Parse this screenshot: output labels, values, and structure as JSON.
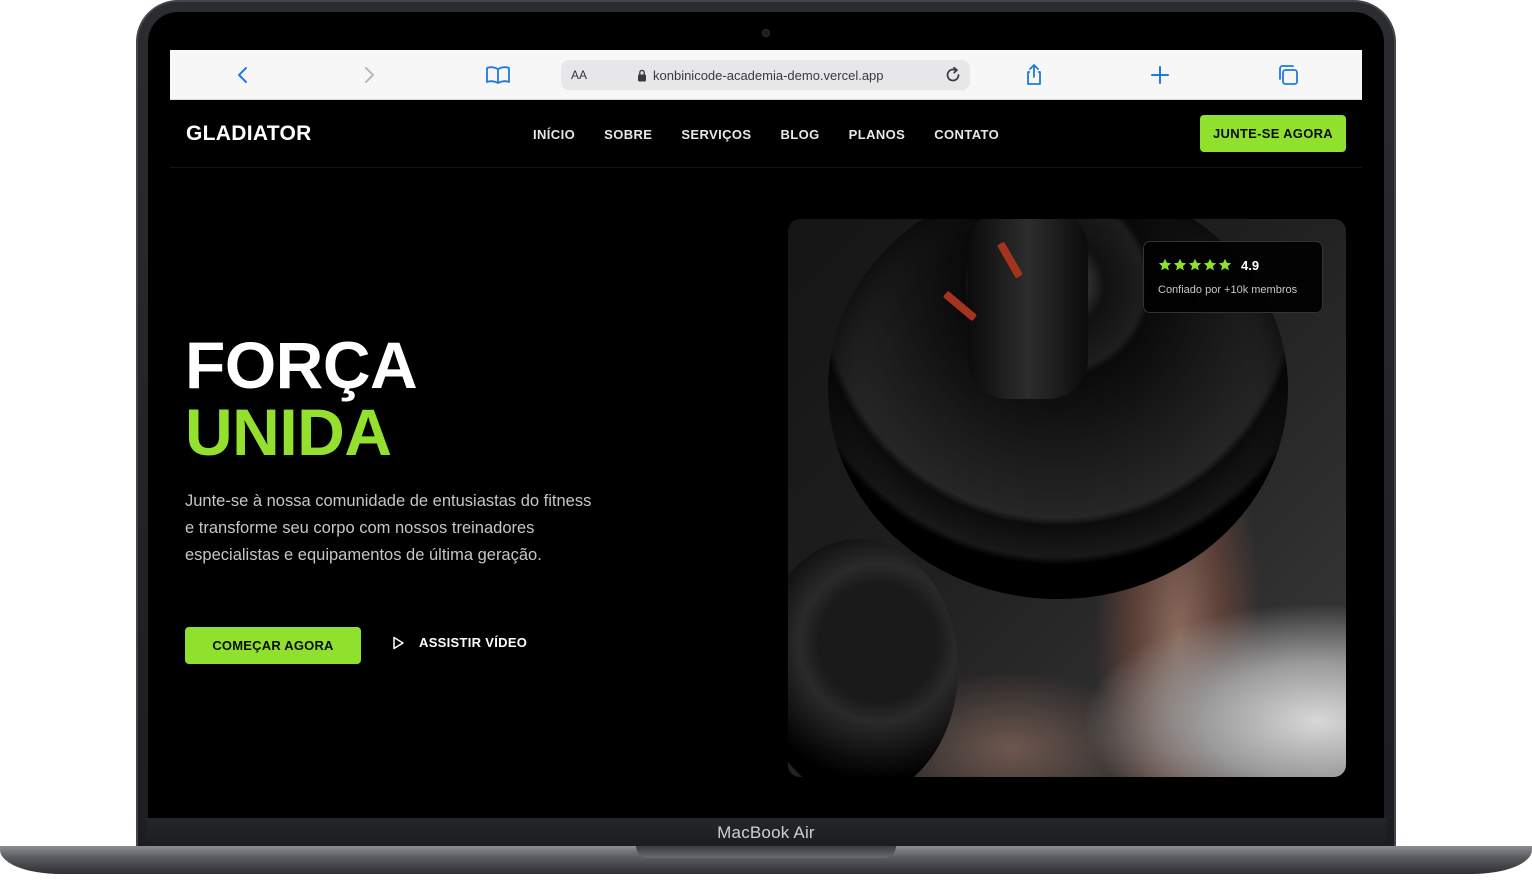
{
  "device": {
    "label": "MacBook Air"
  },
  "browser": {
    "text_size_label": "AA",
    "url": "konbinicode-academia-demo.vercel.app"
  },
  "site": {
    "brand": "GLADIATOR",
    "nav": [
      "INÍCIO",
      "SOBRE",
      "SERVIÇOS",
      "BLOG",
      "PLANOS",
      "CONTATO"
    ],
    "join_button": "JUNTE-SE AGORA"
  },
  "hero": {
    "title_line1": "FORÇA",
    "title_line2": "UNIDA",
    "description": "Junte-se à nossa comunidade de entusiastas do fitness e transforme seu corpo com nossos treinadores especialistas e equipamentos de última geração.",
    "primary_cta": "COMEÇAR AGORA",
    "secondary_cta": "ASSISTIR VÍDEO"
  },
  "rating": {
    "stars": 5,
    "value": "4.9",
    "subtitle": "Confiado por +10k membros"
  },
  "colors": {
    "accent": "#8fe12d",
    "background": "#000000",
    "browser_accent": "#1f7ae0"
  },
  "icons": [
    "back-icon",
    "forward-icon",
    "book-icon",
    "lock-icon",
    "reload-icon",
    "share-icon",
    "plus-icon",
    "tabs-icon",
    "play-icon",
    "star-icon"
  ]
}
